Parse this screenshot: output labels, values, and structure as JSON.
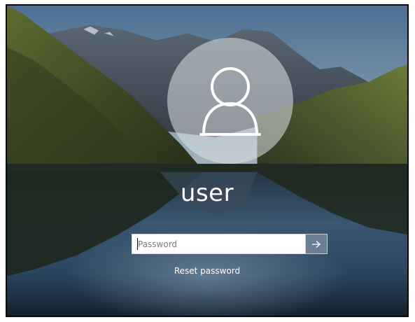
{
  "login": {
    "username": "user",
    "password_placeholder": "Password",
    "password_value": "",
    "submit_icon": "arrow-right-icon",
    "reset_password_label": "Reset password"
  },
  "avatar": {
    "icon": "user-silhouette-icon"
  },
  "wallpaper": {
    "description_icon": "mountain-lake-wallpaper"
  },
  "colors": {
    "text": "#ffffff",
    "input_background": "#ffffff",
    "avatar_circle": "#c9ced3"
  }
}
